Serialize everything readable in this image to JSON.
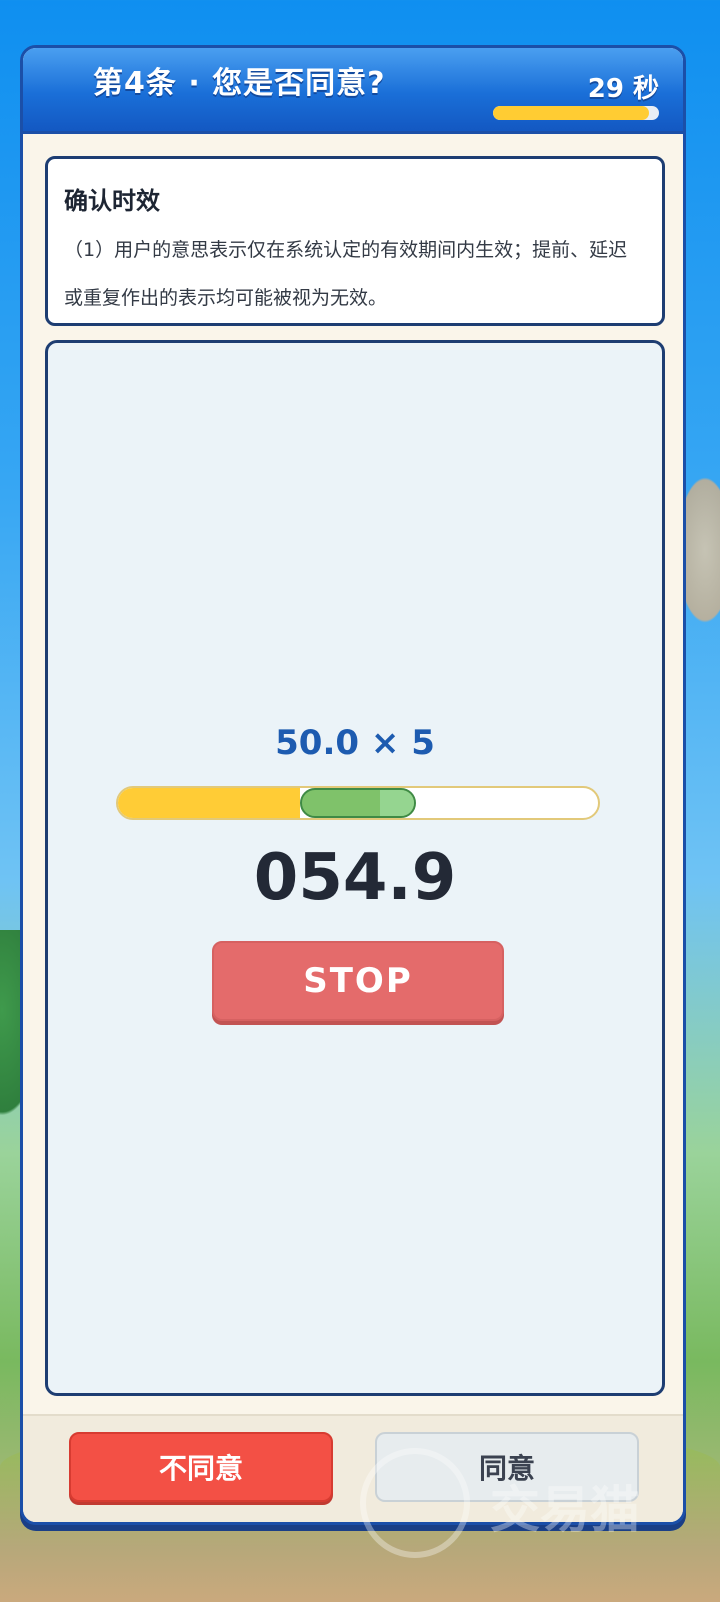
{
  "header": {
    "title": "第4条 · 您是否同意?",
    "timer_text": "29 秒",
    "timer_fraction": 0.94,
    "timer_color": "#ffcc33"
  },
  "rule": {
    "heading": "确认时效",
    "body": "（1）用户的意思表示仅在系统认定的有效期间内生效；提前、延迟或重复作出的表示均可能被视为无效。"
  },
  "game": {
    "formula": "50.0 × 5",
    "readout": "054.9",
    "stop_label": "STOP",
    "slider": {
      "progress_fraction": 0.38,
      "target_start_fraction": 0.38,
      "target_end_fraction": 0.62,
      "fill_color": "#ffcc36",
      "target_color": "#7fc26a"
    }
  },
  "footer": {
    "disagree_label": "不同意",
    "agree_label": "同意"
  },
  "watermark": {
    "text": "交易猫"
  }
}
